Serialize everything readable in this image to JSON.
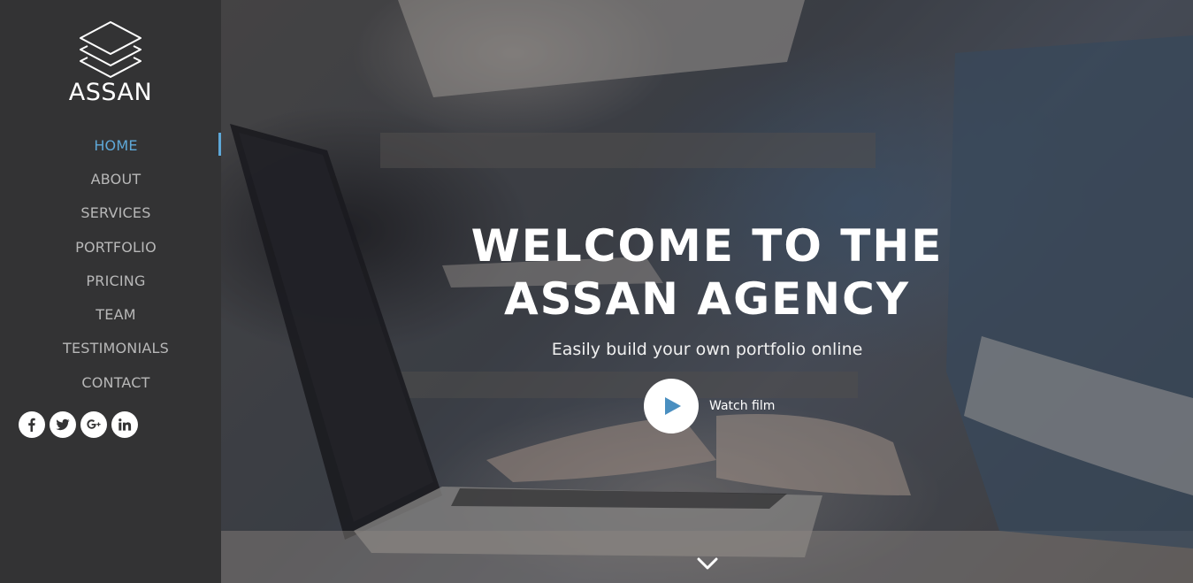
{
  "brand": {
    "name": "ASSAN",
    "logo_icon": "stacked-layers-icon"
  },
  "nav": {
    "items": [
      {
        "label": "HOME",
        "active": true
      },
      {
        "label": "ABOUT",
        "active": false
      },
      {
        "label": "SERVICES",
        "active": false
      },
      {
        "label": "PORTFOLIO",
        "active": false
      },
      {
        "label": "PRICING",
        "active": false
      },
      {
        "label": "TEAM",
        "active": false
      },
      {
        "label": "TESTIMONIALS",
        "active": false
      },
      {
        "label": "CONTACT",
        "active": false
      }
    ]
  },
  "social": [
    "facebook-icon",
    "twitter-icon",
    "google-plus-icon",
    "linkedin-icon"
  ],
  "hero": {
    "headline_line1": "WELCOME TO THE",
    "headline_line2": "ASSAN AGENCY",
    "tagline": "Easily build your own portfolio online",
    "watch_label": "Watch film",
    "play_icon": "play-icon",
    "scroll_icon": "chevron-down-icon"
  },
  "colors": {
    "sidebar_bg": "#333334",
    "accent": "#5ea8d8",
    "nav_text": "#b8b8b8",
    "white": "#ffffff"
  }
}
